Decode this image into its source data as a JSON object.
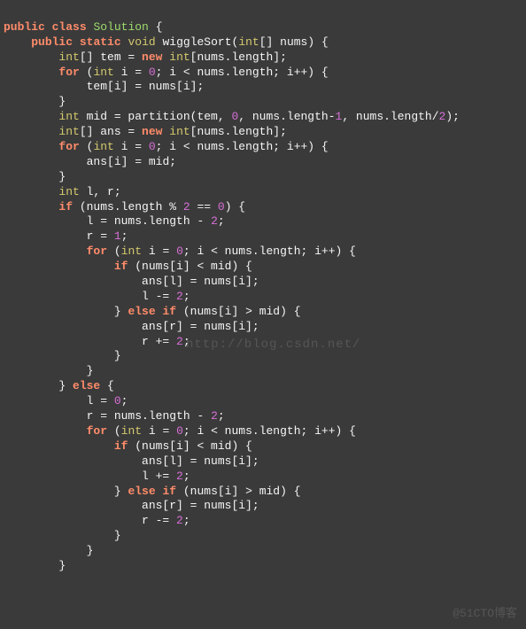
{
  "code": {
    "l1": {
      "a": "public",
      "b": "class",
      "c": "Solution",
      "d": "{"
    },
    "l2": {
      "a": "public",
      "b": "static",
      "c": "void",
      "d": "wiggleSort(",
      "e": "int",
      "f": "[] nums) {"
    },
    "l3": {
      "a": "int",
      "b": "[] tem = ",
      "c": "new",
      "d": " ",
      "e": "int",
      "f": "[nums.length];"
    },
    "l4": {
      "a": "for",
      "b": " (",
      "c": "int",
      "d": " i = ",
      "e": "0",
      "f": "; i < nums.length; i++) {"
    },
    "l5": "tem[i] = nums[i];",
    "l6": "}",
    "l7": {
      "a": "int",
      "b": " mid = partition(tem, ",
      "c": "0",
      "d": ", nums.length-",
      "e": "1",
      "f": ", nums.length/",
      "g": "2",
      "h": ");"
    },
    "l8": {
      "a": "int",
      "b": "[] ans = ",
      "c": "new",
      "d": " ",
      "e": "int",
      "f": "[nums.length];"
    },
    "l9": {
      "a": "for",
      "b": " (",
      "c": "int",
      "d": " i = ",
      "e": "0",
      "f": "; i < nums.length; i++) {"
    },
    "l10": "ans[i] = mid;",
    "l11": "}",
    "l12": {
      "a": "int",
      "b": " l, r;"
    },
    "l13": {
      "a": "if",
      "b": " (nums.length % ",
      "c": "2",
      "d": " == ",
      "e": "0",
      "f": ") {"
    },
    "l14": {
      "a": "l = nums.length - ",
      "b": "2",
      "c": ";"
    },
    "l15": {
      "a": "r = ",
      "b": "1",
      "c": ";"
    },
    "l16": {
      "a": "for",
      "b": " (",
      "c": "int",
      "d": " i = ",
      "e": "0",
      "f": "; i < nums.length; i++) {"
    },
    "l17": {
      "a": "if",
      "b": " (nums[i] < mid) {"
    },
    "l18": "ans[l] = nums[i];",
    "l19": {
      "a": "l -= ",
      "b": "2",
      "c": ";"
    },
    "l20": {
      "a": "} ",
      "b": "else",
      "c": " ",
      "d": "if",
      "e": " (nums[i] > mid) {"
    },
    "l21": "ans[r] = nums[i];",
    "l22": {
      "a": "r += ",
      "b": "2",
      "c": ";"
    },
    "l23": "}",
    "l24": "}",
    "l25": {
      "a": "} ",
      "b": "else",
      "c": " {"
    },
    "l26": {
      "a": "l = ",
      "b": "0",
      "c": ";"
    },
    "l27": {
      "a": "r = nums.length - ",
      "b": "2",
      "c": ";"
    },
    "l28": {
      "a": "for",
      "b": " (",
      "c": "int",
      "d": " i = ",
      "e": "0",
      "f": "; i < nums.length; i++) {"
    },
    "l29": {
      "a": "if",
      "b": " (nums[i] < mid) {"
    },
    "l30": "ans[l] = nums[i];",
    "l31": {
      "a": "l += ",
      "b": "2",
      "c": ";"
    },
    "l32": {
      "a": "} ",
      "b": "else",
      "c": " ",
      "d": "if",
      "e": " (nums[i] > mid) {"
    },
    "l33": "ans[r] = nums[i];",
    "l34": {
      "a": "r -= ",
      "b": "2",
      "c": ";"
    },
    "l35": "}",
    "l36": "}",
    "l37": "}"
  },
  "watermark1": "http://blog.csdn.net/",
  "watermark2": "@51CTO博客"
}
